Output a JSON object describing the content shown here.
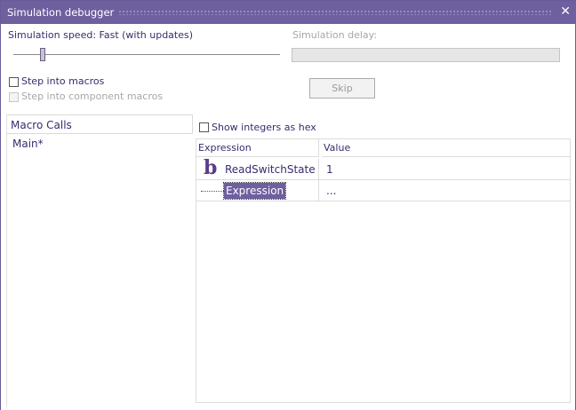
{
  "window": {
    "title": "Simulation debugger",
    "close_glyph": "✕"
  },
  "speed": {
    "label": "Simulation speed: Fast (with updates)"
  },
  "delay": {
    "label": "Simulation delay:"
  },
  "options": {
    "step_into_macros": "Step into macros",
    "step_into_component_macros": "Step into component macros",
    "show_integers_hex": "Show integers as hex"
  },
  "skip_button": "Skip",
  "macro_calls": {
    "header": "Macro Calls",
    "items": [
      "Main*"
    ]
  },
  "watch": {
    "columns": [
      "Expression",
      "Value"
    ],
    "rows": [
      {
        "icon": "b",
        "expression": "ReadSwitchState",
        "value": "1"
      },
      {
        "expression": "Expression",
        "value": "..."
      }
    ]
  },
  "colors": {
    "accent": "#6e5f9e",
    "text": "#3b2a6e"
  }
}
